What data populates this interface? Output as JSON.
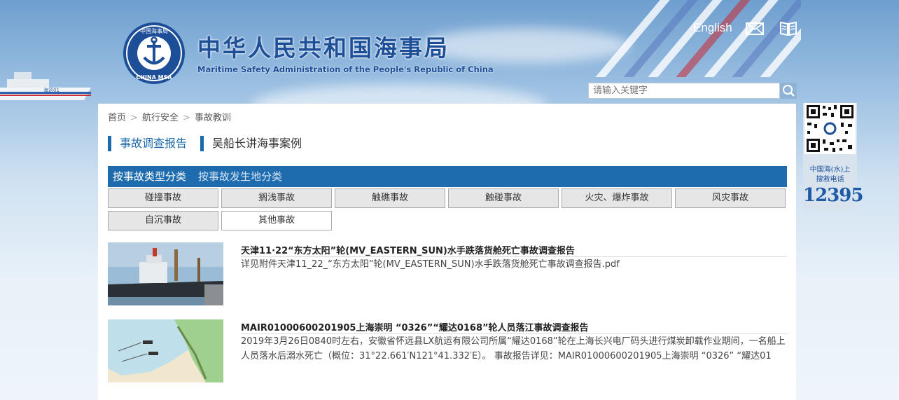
{
  "header": {
    "title_cn": "中华人民共和国海事局",
    "title_en": "Maritime Safety Administration of the People's Republic of China",
    "logo_text_top": "中国海事局",
    "logo_text_bottom": "CHINA MSA",
    "english_link": "English",
    "mail_icon": "mail-icon",
    "book_icon": "book-icon",
    "ship_label": "海巡01"
  },
  "search": {
    "placeholder": "请输入关键字",
    "icon": "search-icon"
  },
  "breadcrumb": [
    "首页",
    "航行安全",
    "事故教训"
  ],
  "breadcrumb_sep": ">",
  "tabs": [
    "事故调查报告",
    "吴船长讲海事案例"
  ],
  "filter_bar": {
    "by_type": "按事故类型分类",
    "by_place": "按事故发生地分类"
  },
  "categories": [
    "碰撞事故",
    "搁浅事故",
    "触礁事故",
    "触碰事故",
    "火灾、爆炸事故",
    "风灾事故",
    "自沉事故",
    "其他事故"
  ],
  "items": [
    {
      "title": "天津11·22“东方太阳”轮(MV_EASTERN_SUN)水手跌落货舱死亡事故调查报告",
      "desc": "详见附件天津11_22_“东方太阳”轮(MV_EASTERN_SUN)水手跌落货舱死亡事故调查报告.pdf"
    },
    {
      "title": "MAIR01000600201905上海崇明 “0326”“耀达0168”轮人员落江事故调查报告",
      "desc": "2019年3月26日0840时左右，安徽省怀远县LX航运有限公司所属“耀达0168”轮在上海长兴电厂码头进行煤炭卸载作业期间，一名船上人员落水后溺水死亡（概位：31°22.661′N121°41.332′E）。 事故报告详见：MAIR01000600201905上海崇明 “0326” “耀达01"
    }
  ],
  "hotline": {
    "caption_line1": "中国海(水)上",
    "caption_line2": "搜救电话",
    "number": "12395"
  },
  "colors": {
    "brand_blue": "#1e6bae",
    "title_blue": "#1d4f99"
  }
}
